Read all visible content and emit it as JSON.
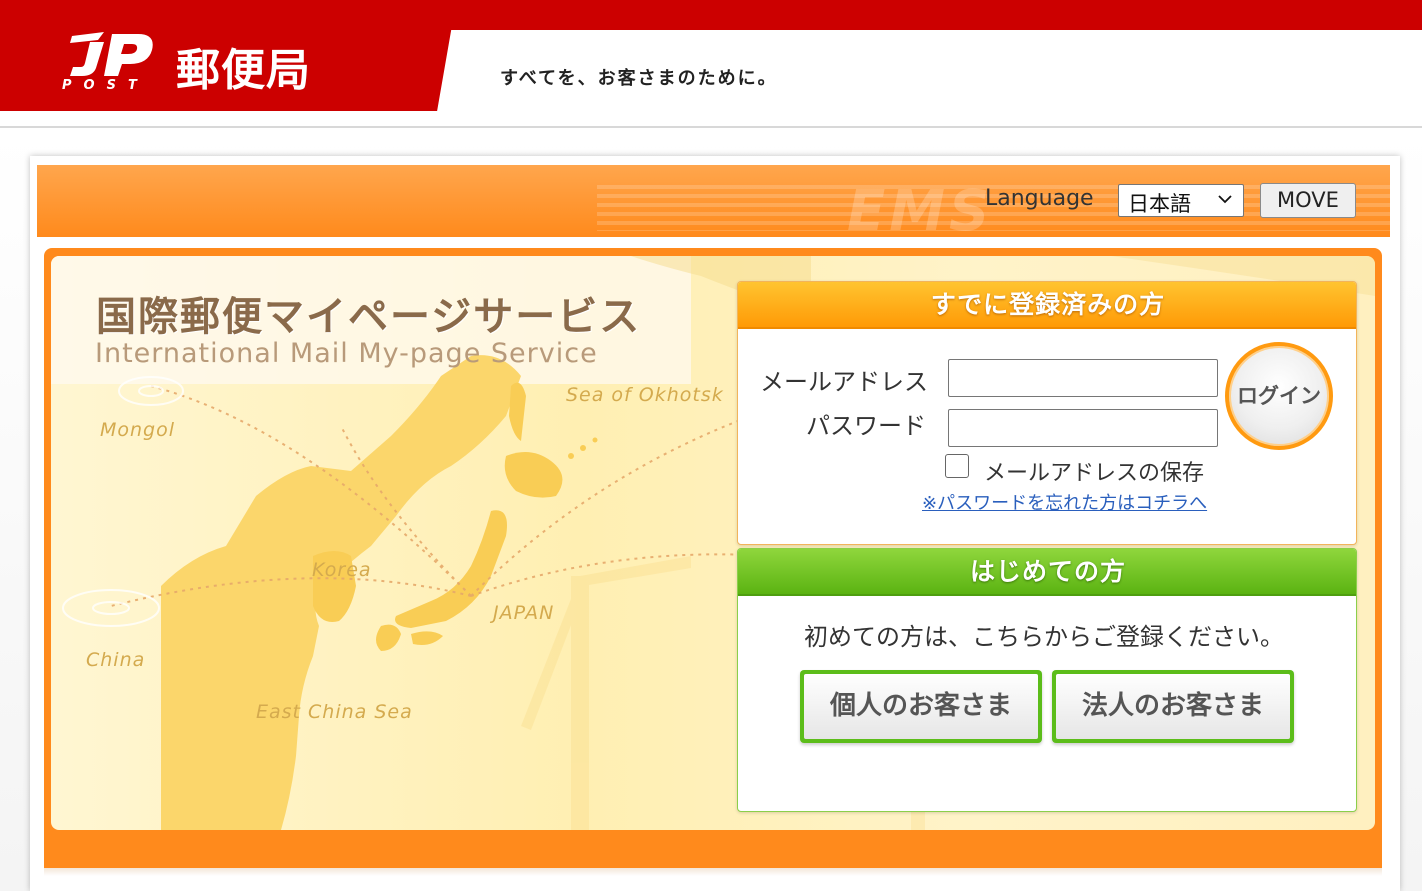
{
  "header": {
    "logo_mark": "JP",
    "logo_sub": "POST",
    "brand": "郵便局",
    "slogan": "すべてを、お客さまのために。",
    "colors": {
      "brand_red": "#cc0000"
    }
  },
  "language_bar": {
    "label": "Language",
    "selected": "日本語",
    "move_label": "MOVE",
    "watermark": "EMS"
  },
  "hero": {
    "title_jp": "国際郵便マイページサービス",
    "title_en": "International Mail My-page Service",
    "map_labels": {
      "okhotsk": "Sea of Okhotsk",
      "mongol": "Mongol",
      "korea": "Korea",
      "japan": "JAPAN",
      "china": "China",
      "east_china_sea": "East China Sea"
    }
  },
  "login": {
    "header": "すでに登録済みの方",
    "email_label": "メールアドレス",
    "email_value": "",
    "password_label": "パスワード",
    "password_value": "",
    "login_button": "ログイン",
    "remember_label": "メールアドレスの保存",
    "forgot_link": "※パスワードを忘れた方はコチラへ",
    "colors": {
      "accent": "#ff9a06"
    }
  },
  "register": {
    "header": "はじめての方",
    "description": "初めての方は、こちらからご登録ください。",
    "personal_button": "個人のお客さま",
    "corporate_button": "法人のお客さま",
    "colors": {
      "accent": "#5cbd1a"
    }
  }
}
